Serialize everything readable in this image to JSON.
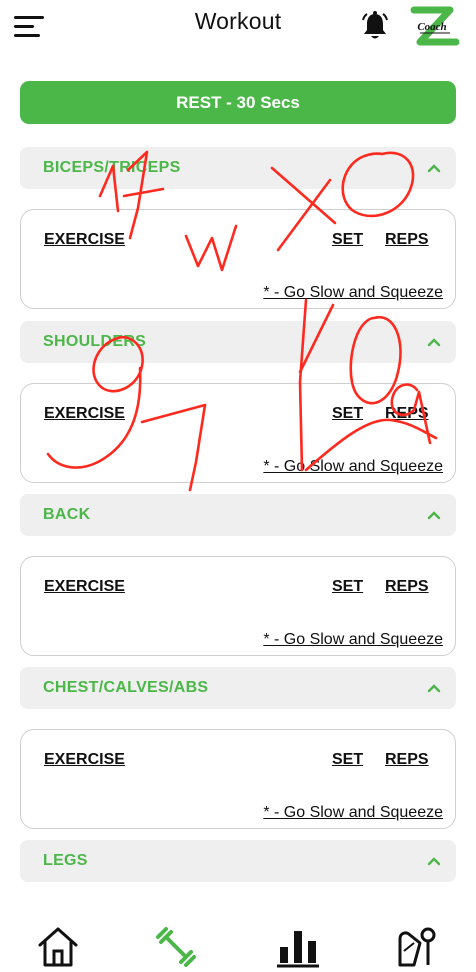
{
  "header": {
    "title": "Workout",
    "menu_icon": "hamburger-menu-icon",
    "bell_icon": "bell-icon",
    "logo_text": "Coach"
  },
  "rest_button": {
    "label": "REST - 30 Secs"
  },
  "sections": [
    {
      "title": "BICEPS/TRICEPS",
      "expanded": true,
      "card": {
        "exercise_label": "EXERCISE",
        "set_label": "SET",
        "reps_label": "REPS",
        "note": "* - Go Slow and Squeeze"
      }
    },
    {
      "title": "SHOULDERS",
      "expanded": true,
      "card": {
        "exercise_label": "EXERCISE",
        "set_label": "SET",
        "reps_label": "REPS",
        "note": "* - Go Slow and Squeeze"
      }
    },
    {
      "title": "BACK",
      "expanded": true,
      "card": {
        "exercise_label": "EXERCISE",
        "set_label": "SET",
        "reps_label": "REPS",
        "note": "* - Go Slow and Squeeze"
      }
    },
    {
      "title": "CHEST/CALVES/ABS",
      "expanded": true,
      "card": {
        "exercise_label": "EXERCISE",
        "set_label": "SET",
        "reps_label": "REPS",
        "note": "* - Go Slow and Squeeze"
      }
    },
    {
      "title": "LEGS",
      "expanded": true
    }
  ],
  "bottom_nav": {
    "items": [
      {
        "icon": "home-icon"
      },
      {
        "icon": "dumbbell-icon",
        "active": true
      },
      {
        "icon": "bar-chart-icon"
      },
      {
        "icon": "body-measure-icon"
      }
    ]
  },
  "colors": {
    "accent": "#4cb749",
    "section_bg": "#efefef",
    "card_border": "#cfcfcf",
    "annotation": "#ff2a1f"
  }
}
